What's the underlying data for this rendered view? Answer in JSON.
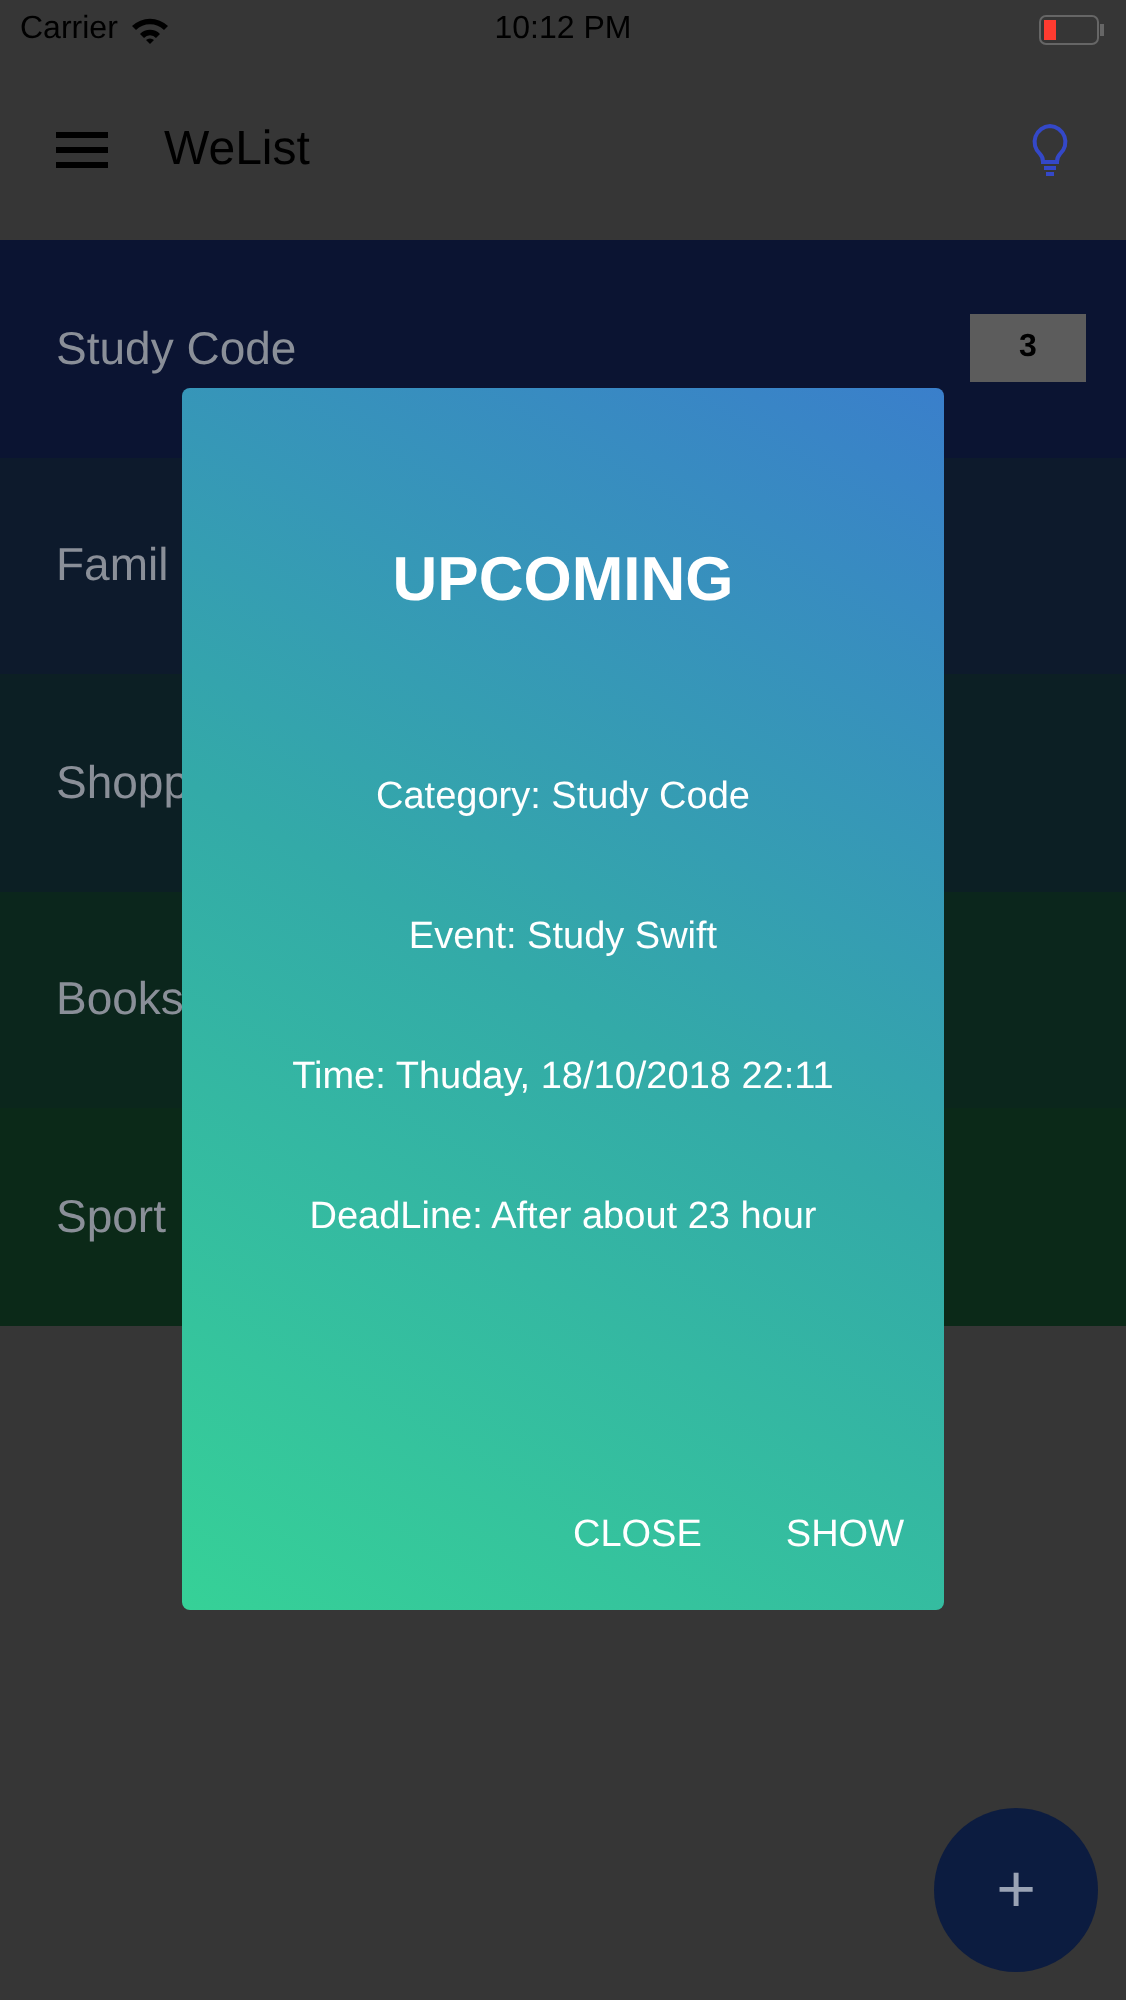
{
  "status_bar": {
    "carrier": "Carrier",
    "time": "10:12 PM"
  },
  "header": {
    "title": "WeList"
  },
  "categories": [
    {
      "name": "Study Code",
      "count": "3",
      "color": "#0b1432"
    },
    {
      "name": "Famil",
      "color": "#0d1a2c"
    },
    {
      "name": "Shopp",
      "color": "#0c1f24"
    },
    {
      "name": "Books",
      "color": "#0b261c"
    },
    {
      "name": "Sport",
      "color": "#0b2918"
    }
  ],
  "dialog": {
    "title": "UPCOMING",
    "lines": [
      "Category: Study Code",
      "Event: Study Swift",
      "Time: Thuday, 18/10/2018 22:11",
      "DeadLine: After about 23 hour"
    ],
    "buttons": [
      "CLOSE",
      "SHOW"
    ]
  },
  "fab": {
    "label": "+"
  }
}
